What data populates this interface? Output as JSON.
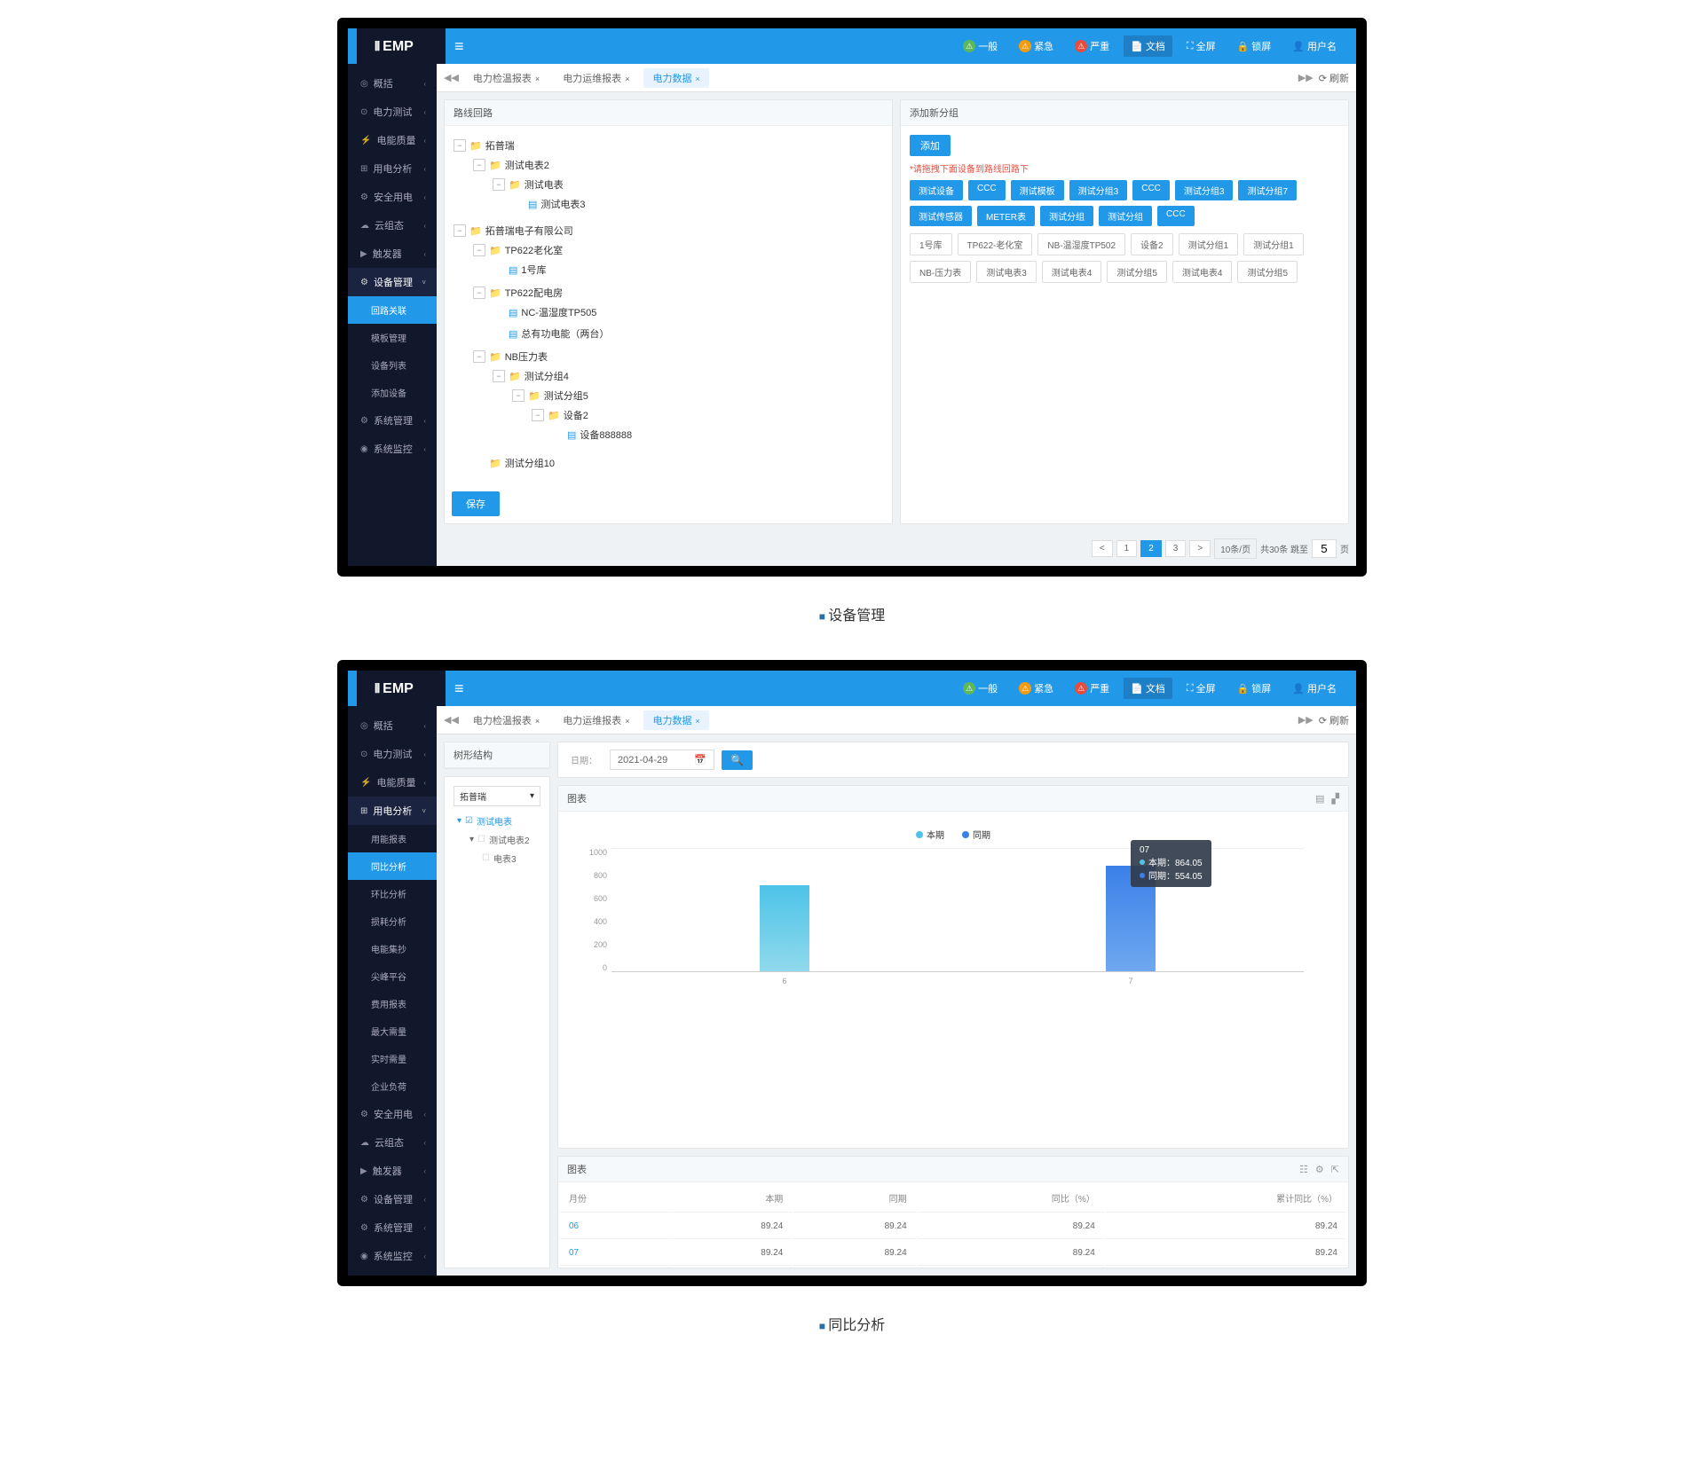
{
  "brand": "EMP",
  "topbar": {
    "status": [
      {
        "icon": "green",
        "label": "一般"
      },
      {
        "icon": "orange",
        "label": "紧急"
      },
      {
        "icon": "red",
        "label": "严重"
      }
    ],
    "actions": [
      {
        "icon": "📄",
        "label": "文档",
        "active": true
      },
      {
        "icon": "⛶",
        "label": "全屏"
      },
      {
        "icon": "🔒",
        "label": "锁屏"
      },
      {
        "icon": "👤",
        "label": "用户名"
      }
    ]
  },
  "tabs": {
    "prev": "◀◀",
    "items": [
      {
        "label": "电力检温报表"
      },
      {
        "label": "电力运维报表"
      },
      {
        "label": "电力数据",
        "active": true
      }
    ],
    "next": "▶▶",
    "refresh": "刷新"
  },
  "captions": {
    "one": "设备管理",
    "two": "同比分析"
  },
  "shot1": {
    "sidebar": [
      {
        "ico": "◎",
        "label": "概括",
        "chev": true
      },
      {
        "ico": "⊙",
        "label": "电力测试",
        "chev": true
      },
      {
        "ico": "⚡",
        "label": "电能质量",
        "chev": true
      },
      {
        "ico": "⊞",
        "label": "用电分析",
        "chev": true
      },
      {
        "ico": "⚙",
        "label": "安全用电",
        "chev": true
      },
      {
        "ico": "☁",
        "label": "云组态",
        "chev": true
      },
      {
        "ico": "▶",
        "label": "触发器",
        "chev": true
      },
      {
        "ico": "⚙",
        "label": "设备管理",
        "chev": true,
        "active": true,
        "subs": [
          {
            "label": "回路关联",
            "selected": true
          },
          {
            "label": "模板管理"
          },
          {
            "label": "设备列表"
          },
          {
            "label": "添加设备"
          }
        ]
      },
      {
        "ico": "⚙",
        "label": "系统管理",
        "chev": true
      },
      {
        "ico": "◉",
        "label": "系统监控",
        "chev": true
      }
    ],
    "left_panel": {
      "title": "路线回路",
      "save": "保存"
    },
    "tree": [
      {
        "l": "拓普瑞",
        "kids": [
          {
            "l": "测试电表2",
            "kids": [
              {
                "l": "测试电表",
                "kids": [
                  {
                    "l": "测试电表3",
                    "file": true
                  }
                ]
              }
            ]
          }
        ]
      },
      {
        "l": "拓普瑞电子有限公司",
        "kids": [
          {
            "l": "TP622老化室",
            "kids": [
              {
                "l": "1号库",
                "file": true
              }
            ]
          },
          {
            "l": "TP622配电房",
            "kids": [
              {
                "l": "NC-温湿度TP505",
                "file": true
              },
              {
                "l": "总有功电能（两台）",
                "file": true
              }
            ]
          },
          {
            "l": "NB压力表",
            "kids": [
              {
                "l": "测试分组4",
                "kids": [
                  {
                    "l": "测试分组5",
                    "kids": [
                      {
                        "l": "设备2",
                        "kids": [
                          {
                            "l": "设备888888",
                            "file": true
                          }
                        ]
                      }
                    ]
                  }
                ]
              }
            ]
          },
          {
            "l": "测试分组10"
          }
        ]
      }
    ],
    "right_panel": {
      "title": "添加新分组",
      "add": "添加",
      "note": "*请拖拽下面设备到路线回路下",
      "selected": [
        "测试设备",
        "CCC",
        "测试模板",
        "测试分组3",
        "CCC",
        "测试分组3",
        "测试分组7",
        "测试传感器",
        "METER表",
        "测试分组",
        "测试分组",
        "CCC"
      ],
      "unselected": [
        "1号库",
        "TP622-老化室",
        "NB-温湿度TP502",
        "设备2",
        "测试分组1",
        "测试分组1",
        "NB-压力表",
        "测试电表3",
        "测试电表4",
        "测试分组5",
        "测试电表4",
        "测试分组5"
      ]
    },
    "pager": {
      "pages": [
        "1",
        "2",
        "3"
      ],
      "active": "2",
      "per": "10条/页",
      "total": "共30条 跳至",
      "unit": "页",
      "goto": "5"
    }
  },
  "shot2": {
    "sidebar": [
      {
        "ico": "◎",
        "label": "概括",
        "chev": true
      },
      {
        "ico": "⊙",
        "label": "电力测试",
        "chev": true
      },
      {
        "ico": "⚡",
        "label": "电能质量",
        "chev": true
      },
      {
        "ico": "⊞",
        "label": "用电分析",
        "chev": true,
        "active": true,
        "subs": [
          {
            "label": "用能报表"
          },
          {
            "label": "同比分析",
            "selected": true
          },
          {
            "label": "环比分析"
          },
          {
            "label": "损耗分析"
          },
          {
            "label": "电能集抄"
          },
          {
            "label": "尖峰平谷"
          },
          {
            "label": "费用报表"
          },
          {
            "label": "最大需量"
          },
          {
            "label": "实时需量"
          },
          {
            "label": "企业负荷"
          }
        ]
      },
      {
        "ico": "⚙",
        "label": "安全用电",
        "chev": true
      },
      {
        "ico": "☁",
        "label": "云组态",
        "chev": true
      },
      {
        "ico": "▶",
        "label": "触发器",
        "chev": true
      },
      {
        "ico": "⚙",
        "label": "设备管理",
        "chev": true
      },
      {
        "ico": "⚙",
        "label": "系统管理",
        "chev": true
      },
      {
        "ico": "◉",
        "label": "系统监控",
        "chev": true
      }
    ],
    "tree_panel": {
      "title": "树形结构",
      "root": "拓普瑞",
      "items": [
        {
          "label": "测试电表",
          "active": true,
          "exp": true
        },
        {
          "label": "测试电表2",
          "sub": true,
          "exp": true
        },
        {
          "label": "电表3",
          "sub": true
        }
      ]
    },
    "toolbar": {
      "date_label": "日期：",
      "date": "2021-04-29"
    },
    "chart_title": "图表",
    "table_title": "图表",
    "legend": [
      {
        "label": "本期",
        "color": "#4dc3e8"
      },
      {
        "label": "同期",
        "color": "#3a80e8"
      }
    ],
    "tooltip": {
      "head": "07",
      "rows": [
        {
          "color": "#4dc3e8",
          "text": "本期：864.05"
        },
        {
          "color": "#3a80e8",
          "text": "同期：554.05"
        }
      ]
    },
    "table": {
      "headers": [
        "月份",
        "本期",
        "同期",
        "同比（%）",
        "累计同比（%）"
      ],
      "rows": [
        [
          "06",
          "89.24",
          "89.24",
          "89.24",
          "89.24"
        ],
        [
          "07",
          "89.24",
          "89.24",
          "89.24",
          "89.24"
        ]
      ]
    }
  },
  "chart_data": {
    "type": "bar",
    "categories": [
      "6",
      "7"
    ],
    "series": [
      {
        "name": "本期",
        "values": [
          700,
          864.05
        ]
      },
      {
        "name": "同期",
        "values": [
          null,
          554.05
        ]
      }
    ],
    "ylim": [
      0,
      1000
    ],
    "yticks": [
      0,
      200,
      400,
      600,
      800,
      1000
    ],
    "xlabel": "",
    "ylabel": "",
    "title": "图表"
  }
}
